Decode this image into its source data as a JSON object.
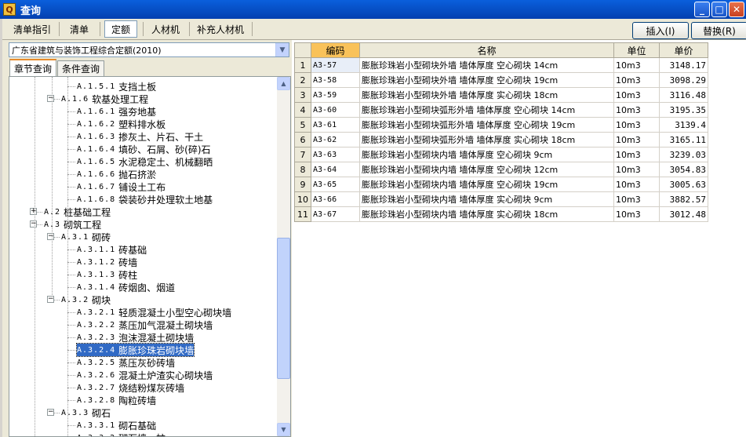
{
  "window": {
    "title": "查询",
    "icon": "app-icon",
    "min": "_",
    "max": "□",
    "close": "✕"
  },
  "toolbar": {
    "tabs": [
      {
        "label": "清单指引",
        "active": false
      },
      {
        "label": "清单",
        "active": false
      },
      {
        "label": "定额",
        "active": true
      },
      {
        "label": "人材机",
        "active": false
      },
      {
        "label": "补充人材机",
        "active": false
      }
    ],
    "insert_label": "插入(I)",
    "replace_label": "替换(R)"
  },
  "left": {
    "combo_value": "广东省建筑与装饰工程综合定额(2010)",
    "subtabs": [
      "章节查询",
      "条件查询"
    ],
    "tree": [
      {
        "level": 3,
        "code": "A.1.5.1",
        "label": "支挡土板"
      },
      {
        "level": 2,
        "code": "A.1.6",
        "label": "软基处理工程",
        "expander": "−"
      },
      {
        "level": 3,
        "code": "A.1.6.1",
        "label": "强夯地基"
      },
      {
        "level": 3,
        "code": "A.1.6.2",
        "label": "塑料排水板"
      },
      {
        "level": 3,
        "code": "A.1.6.3",
        "label": "掺灰土、片石、干土"
      },
      {
        "level": 3,
        "code": "A.1.6.4",
        "label": "填砂、石屑、砂(碎)石"
      },
      {
        "level": 3,
        "code": "A.1.6.5",
        "label": "水泥稳定土、机械翻晒"
      },
      {
        "level": 3,
        "code": "A.1.6.6",
        "label": "抛石挤淤"
      },
      {
        "level": 3,
        "code": "A.1.6.7",
        "label": "铺设土工布"
      },
      {
        "level": 3,
        "code": "A.1.6.8",
        "label": "袋装砂井处理软土地基"
      },
      {
        "level": 1,
        "code": "A.2",
        "label": "桩基础工程",
        "expander": "+"
      },
      {
        "level": 1,
        "code": "A.3",
        "label": "砌筑工程",
        "expander": "−"
      },
      {
        "level": 2,
        "code": "A.3.1",
        "label": "砌砖",
        "expander": "−"
      },
      {
        "level": 3,
        "code": "A.3.1.1",
        "label": "砖基础"
      },
      {
        "level": 3,
        "code": "A.3.1.2",
        "label": "砖墙"
      },
      {
        "level": 3,
        "code": "A.3.1.3",
        "label": "砖柱"
      },
      {
        "level": 3,
        "code": "A.3.1.4",
        "label": "砖烟囱、烟道"
      },
      {
        "level": 2,
        "code": "A.3.2",
        "label": "砌块",
        "expander": "−"
      },
      {
        "level": 3,
        "code": "A.3.2.1",
        "label": "轻质混凝土小型空心砌块墙"
      },
      {
        "level": 3,
        "code": "A.3.2.2",
        "label": "蒸压加气混凝土砌块墙"
      },
      {
        "level": 3,
        "code": "A.3.2.3",
        "label": "泡沫混凝土砌块墙"
      },
      {
        "level": 3,
        "code": "A.3.2.4",
        "label": "膨胀珍珠岩砌块墙",
        "selected": true
      },
      {
        "level": 3,
        "code": "A.3.2.5",
        "label": "蒸压灰砂砖墙"
      },
      {
        "level": 3,
        "code": "A.3.2.6",
        "label": "混凝土炉渣实心砌块墙"
      },
      {
        "level": 3,
        "code": "A.3.2.7",
        "label": "烧结粉煤灰砖墙"
      },
      {
        "level": 3,
        "code": "A.3.2.8",
        "label": "陶粒砖墙"
      },
      {
        "level": 2,
        "code": "A.3.3",
        "label": "砌石",
        "expander": "−"
      },
      {
        "level": 3,
        "code": "A.3.3.1",
        "label": "砌石基础"
      },
      {
        "level": 3,
        "code": "A.3.3.2",
        "label": "砌石墙、柱"
      }
    ]
  },
  "table": {
    "headers": [
      "",
      "编码",
      "名称",
      "单位",
      "单价"
    ],
    "rows": [
      {
        "n": "1",
        "code": "A3-57",
        "name": "膨胀珍珠岩小型砌块外墙 墙体厚度 空心砌块 14cm",
        "unit": "10m3",
        "price": "3148.17"
      },
      {
        "n": "2",
        "code": "A3-58",
        "name": "膨胀珍珠岩小型砌块外墙 墙体厚度 空心砌块 19cm",
        "unit": "10m3",
        "price": "3098.29"
      },
      {
        "n": "3",
        "code": "A3-59",
        "name": "膨胀珍珠岩小型砌块外墙 墙体厚度 实心砌块 18cm",
        "unit": "10m3",
        "price": "3116.48"
      },
      {
        "n": "4",
        "code": "A3-60",
        "name": "膨胀珍珠岩小型砌块弧形外墙 墙体厚度 空心砌块 14cm",
        "unit": "10m3",
        "price": "3195.35"
      },
      {
        "n": "5",
        "code": "A3-61",
        "name": "膨胀珍珠岩小型砌块弧形外墙 墙体厚度 空心砌块 19cm",
        "unit": "10m3",
        "price": "3139.4"
      },
      {
        "n": "6",
        "code": "A3-62",
        "name": "膨胀珍珠岩小型砌块弧形外墙 墙体厚度 实心砌块 18cm",
        "unit": "10m3",
        "price": "3165.11"
      },
      {
        "n": "7",
        "code": "A3-63",
        "name": "膨胀珍珠岩小型砌块内墙 墙体厚度 空心砌块 9cm",
        "unit": "10m3",
        "price": "3239.03"
      },
      {
        "n": "8",
        "code": "A3-64",
        "name": "膨胀珍珠岩小型砌块内墙 墙体厚度 空心砌块 12cm",
        "unit": "10m3",
        "price": "3054.83"
      },
      {
        "n": "9",
        "code": "A3-65",
        "name": "膨胀珍珠岩小型砌块内墙 墙体厚度 空心砌块 19cm",
        "unit": "10m3",
        "price": "3005.63"
      },
      {
        "n": "10",
        "code": "A3-66",
        "name": "膨胀珍珠岩小型砌块内墙 墙体厚度 实心砌块 9cm",
        "unit": "10m3",
        "price": "3882.57"
      },
      {
        "n": "11",
        "code": "A3-67",
        "name": "膨胀珍珠岩小型砌块内墙 墙体厚度 实心砌块 18cm",
        "unit": "10m3",
        "price": "3012.48"
      }
    ]
  },
  "colors": {
    "titlebar": "#0a5fdc",
    "selection": "#316ac5",
    "header_highlight": "#f9c25a"
  }
}
